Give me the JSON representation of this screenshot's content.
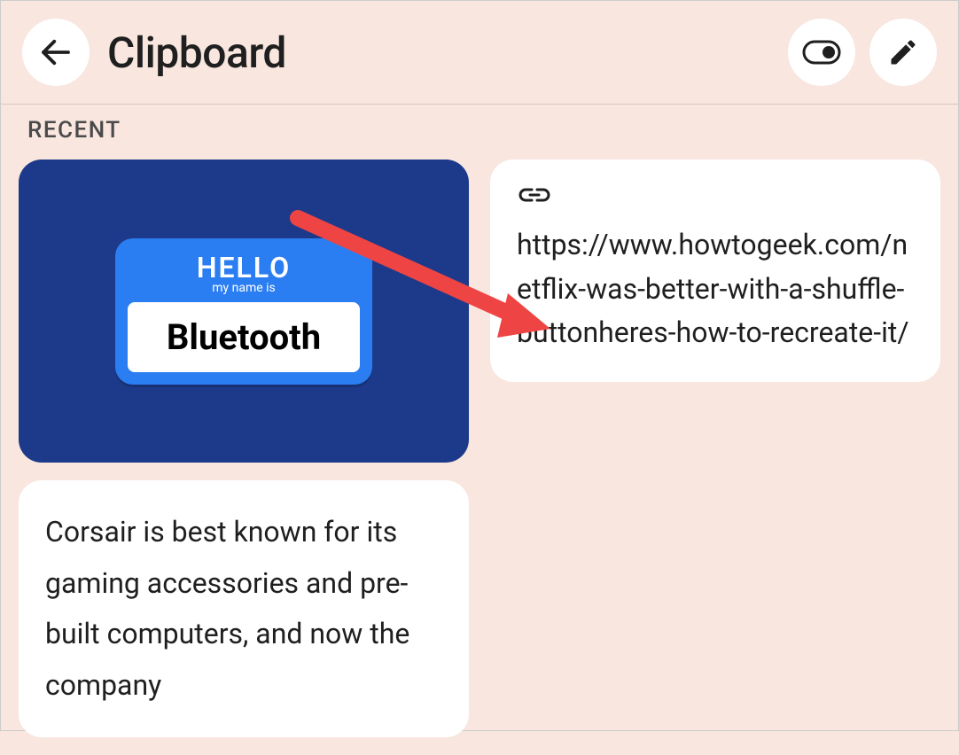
{
  "header": {
    "title": "Clipboard"
  },
  "section": {
    "label": "RECENT"
  },
  "image_clip": {
    "nametag_hello": "HELLO",
    "nametag_sub": "my name is",
    "nametag_name": "Bluetooth"
  },
  "text_clip": {
    "content": "Corsair is best known for its gaming accessories and pre-built computers, and now the company"
  },
  "link_clip": {
    "url": "https://www.howtogeek.com/netflix-was-better-with-a-shuffle-buttonheres-how-to-recreate-it/"
  }
}
